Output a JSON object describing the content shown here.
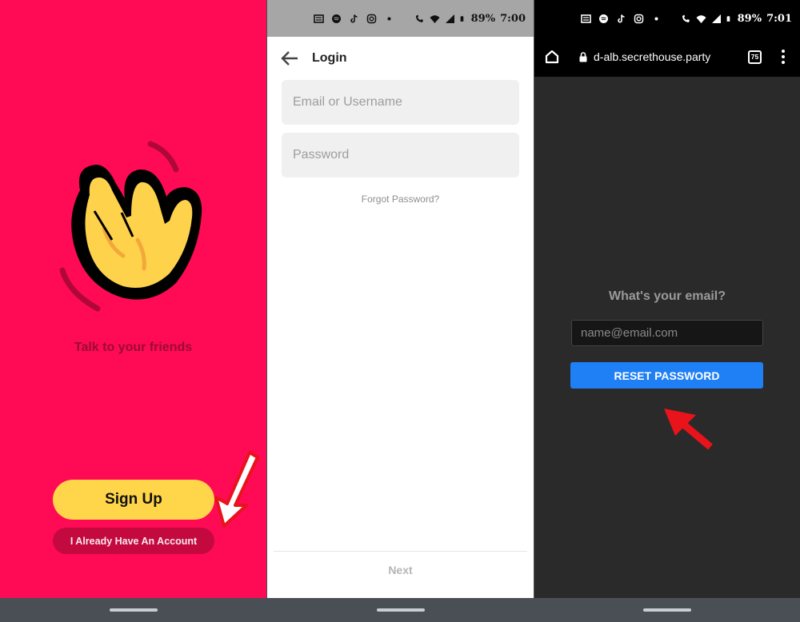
{
  "panel_signup": {
    "tagline": "Talk to your friends",
    "signup_label": "Sign Up",
    "account_label": "I Already Have An Account",
    "accent_color": "#ff0a55"
  },
  "panel_login": {
    "status_bar": {
      "battery": "89%",
      "time": "7:00"
    },
    "title": "Login",
    "email_placeholder": "Email or Username",
    "password_placeholder": "Password",
    "forgot_label": "Forgot Password?",
    "next_label": "Next"
  },
  "panel_reset": {
    "status_bar": {
      "battery": "89%",
      "time": "7:01"
    },
    "url": "d-alb.secrethouse.party",
    "tab_count": "75",
    "question": "What's your email?",
    "email_placeholder": "name@email.com",
    "reset_label": "RESET PASSWORD",
    "button_color": "#1f7ff5"
  },
  "status_icons": [
    "news-icon",
    "spotify-icon",
    "tiktok-icon",
    "instagram-icon",
    "dot-icon",
    "wifi-calling-icon",
    "wifi-icon",
    "signal-icon",
    "battery-icon"
  ]
}
